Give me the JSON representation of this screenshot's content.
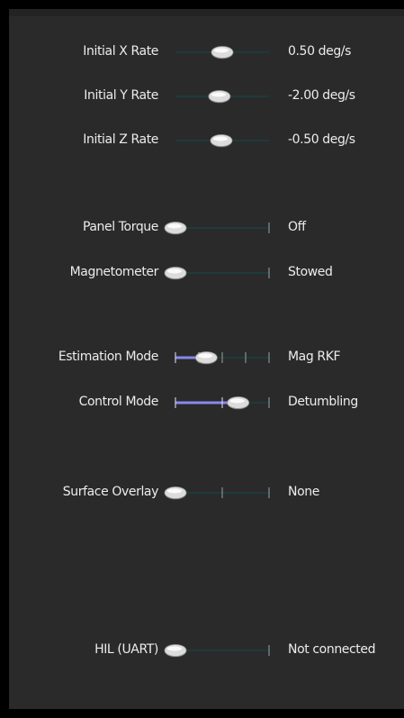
{
  "controls": [
    {
      "id": "init-x-rate",
      "label": "Initial X Rate",
      "value": "0.50 deg/s",
      "kind": "continuous",
      "pos": 0.5,
      "ticks": 0,
      "filled": false
    },
    {
      "id": "init-y-rate",
      "label": "Initial Y Rate",
      "value": "-2.00 deg/s",
      "kind": "continuous",
      "pos": 0.47,
      "ticks": 0,
      "filled": false
    },
    {
      "id": "init-z-rate",
      "label": "Initial Z Rate",
      "value": "-0.50 deg/s",
      "kind": "continuous",
      "pos": 0.49,
      "ticks": 0,
      "filled": false
    },
    {
      "id": "panel-torque",
      "label": "Panel Torque",
      "value": "Off",
      "kind": "toggle",
      "pos": 0.0,
      "ticks": 1,
      "filled": false
    },
    {
      "id": "magnetometer",
      "label": "Magnetometer",
      "value": "Stowed",
      "kind": "toggle",
      "pos": 0.0,
      "ticks": 1,
      "filled": false
    },
    {
      "id": "estimation-mode",
      "label": "Estimation Mode",
      "value": "Mag RKF",
      "kind": "discrete",
      "pos": 0.33,
      "ticks": 5,
      "filled": true
    },
    {
      "id": "control-mode",
      "label": "Control Mode",
      "value": "Detumbling",
      "kind": "discrete",
      "pos": 0.67,
      "ticks": 3,
      "filled": true
    },
    {
      "id": "surface-overlay",
      "label": "Surface Overlay",
      "value": "None",
      "kind": "discrete",
      "pos": 0.0,
      "ticks": 3,
      "filled": false
    },
    {
      "id": "hil-uart",
      "label": "HIL (UART)",
      "value": "Not connected",
      "kind": "toggle",
      "pos": 0.0,
      "ticks": 1,
      "filled": false
    }
  ],
  "colors": {
    "background": "#2a2a2a",
    "text": "#ececec",
    "track": "#1d3b3b",
    "tick": "#9aa3a3",
    "fill": "#8888ee",
    "knob": "#dcdcdc"
  }
}
